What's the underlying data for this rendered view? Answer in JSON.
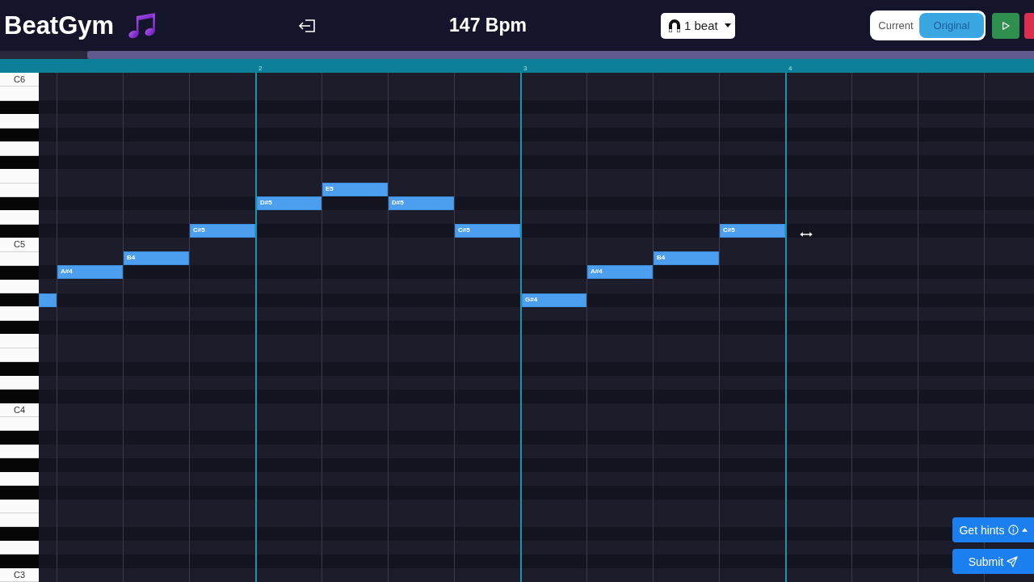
{
  "header": {
    "logo": "BeatGym",
    "tempo": "147 Bpm",
    "snap": {
      "label": "1 beat"
    },
    "view_toggle": [
      {
        "label": "Current",
        "selected": false
      },
      {
        "label": "Original",
        "selected": true
      }
    ]
  },
  "timeline": {
    "columns": [
      {
        "kind": "partial"
      },
      {
        "kind": "beat"
      },
      {
        "kind": "beat"
      },
      {
        "kind": "beat"
      },
      {
        "kind": "bar",
        "label": "2"
      },
      {
        "kind": "beat"
      },
      {
        "kind": "beat"
      },
      {
        "kind": "beat"
      },
      {
        "kind": "bar",
        "label": "3"
      },
      {
        "kind": "beat"
      },
      {
        "kind": "beat"
      },
      {
        "kind": "beat"
      },
      {
        "kind": "bar",
        "label": "4"
      },
      {
        "kind": "beat"
      },
      {
        "kind": "beat"
      },
      {
        "kind": "beat"
      }
    ]
  },
  "piano_roll": {
    "keys": [
      {
        "kind": "white",
        "label": "C6"
      },
      {
        "kind": "white"
      },
      {
        "kind": "black"
      },
      {
        "kind": "white"
      },
      {
        "kind": "black"
      },
      {
        "kind": "white"
      },
      {
        "kind": "black"
      },
      {
        "kind": "white"
      },
      {
        "kind": "white",
        "beats": [
          {
            "kind": "rest"
          },
          {
            "kind": "rest"
          },
          {
            "kind": "rest"
          },
          {
            "kind": "rest"
          },
          {
            "kind": "rest"
          },
          {
            "kind": "note",
            "label": "E5"
          }
        ]
      },
      {
        "kind": "black",
        "beats": [
          {
            "kind": "rest"
          },
          {
            "kind": "rest"
          },
          {
            "kind": "rest"
          },
          {
            "kind": "rest"
          },
          {
            "kind": "note",
            "label": "D#5"
          },
          {
            "kind": "rest"
          },
          {
            "kind": "note",
            "label": "D#5"
          }
        ]
      },
      {
        "kind": "white"
      },
      {
        "kind": "black",
        "beats": [
          {
            "kind": "rest"
          },
          {
            "kind": "rest"
          },
          {
            "kind": "rest"
          },
          {
            "kind": "note",
            "label": "C#5"
          },
          {
            "kind": "rest"
          },
          {
            "kind": "rest"
          },
          {
            "kind": "rest"
          },
          {
            "kind": "note",
            "label": "C#5"
          },
          {
            "kind": "rest"
          },
          {
            "kind": "rest"
          },
          {
            "kind": "rest"
          },
          {
            "kind": "note",
            "label": "C#5"
          }
        ]
      },
      {
        "kind": "white",
        "label": "C5"
      },
      {
        "kind": "white",
        "beats": [
          {
            "kind": "rest"
          },
          {
            "kind": "rest"
          },
          {
            "kind": "note",
            "label": "B4"
          },
          {
            "kind": "rest"
          },
          {
            "kind": "rest"
          },
          {
            "kind": "rest"
          },
          {
            "kind": "rest"
          },
          {
            "kind": "rest"
          },
          {
            "kind": "rest"
          },
          {
            "kind": "rest"
          },
          {
            "kind": "note",
            "label": "B4"
          }
        ]
      },
      {
        "kind": "black",
        "beats": [
          {
            "kind": "rest"
          },
          {
            "kind": "note",
            "label": "A#4"
          },
          {
            "kind": "rest"
          },
          {
            "kind": "rest"
          },
          {
            "kind": "rest"
          },
          {
            "kind": "rest"
          },
          {
            "kind": "rest"
          },
          {
            "kind": "rest"
          },
          {
            "kind": "rest"
          },
          {
            "kind": "note",
            "label": "A#4"
          }
        ]
      },
      {
        "kind": "white"
      },
      {
        "kind": "black",
        "beats": [
          {
            "kind": "note"
          },
          {
            "kind": "rest"
          },
          {
            "kind": "rest"
          },
          {
            "kind": "rest"
          },
          {
            "kind": "rest"
          },
          {
            "kind": "rest"
          },
          {
            "kind": "rest"
          },
          {
            "kind": "rest"
          },
          {
            "kind": "note",
            "label": "G#4"
          }
        ]
      },
      {
        "kind": "white"
      },
      {
        "kind": "black"
      },
      {
        "kind": "white"
      },
      {
        "kind": "white"
      },
      {
        "kind": "black"
      },
      {
        "kind": "white"
      },
      {
        "kind": "black"
      },
      {
        "kind": "white",
        "label": "C4"
      },
      {
        "kind": "white"
      },
      {
        "kind": "black"
      },
      {
        "kind": "white"
      },
      {
        "kind": "black"
      },
      {
        "kind": "white"
      },
      {
        "kind": "black"
      },
      {
        "kind": "white"
      },
      {
        "kind": "white"
      },
      {
        "kind": "black"
      },
      {
        "kind": "white"
      },
      {
        "kind": "black"
      },
      {
        "kind": "white",
        "label": "C3"
      }
    ]
  },
  "actions": [
    {
      "kind": "hints",
      "label": "Get hints"
    },
    {
      "kind": "submit",
      "label": "Submit"
    }
  ]
}
